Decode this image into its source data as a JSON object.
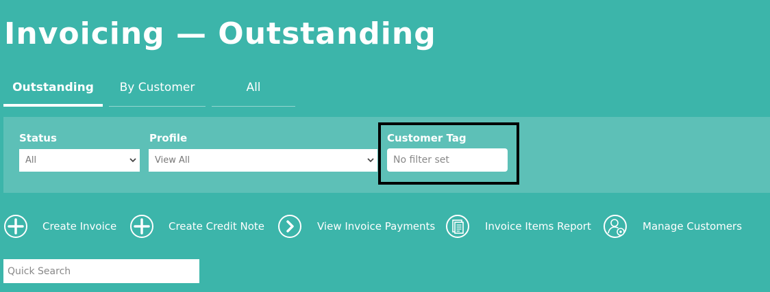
{
  "page": {
    "title": "Invoicing — Outstanding"
  },
  "tabs": [
    {
      "label": "Outstanding",
      "active": true
    },
    {
      "label": "By Customer",
      "active": false
    },
    {
      "label": "All",
      "active": false
    }
  ],
  "filters": {
    "status": {
      "label": "Status",
      "value": "All"
    },
    "profile": {
      "label": "Profile",
      "value": "View All"
    },
    "customer_tag": {
      "label": "Customer Tag",
      "value": "No filter set"
    }
  },
  "actions": [
    {
      "label": "Create Invoice",
      "icon": "plus-circle-icon"
    },
    {
      "label": "Create Credit Note",
      "icon": "plus-circle-icon"
    },
    {
      "label": "View Invoice Payments",
      "icon": "chevron-right-circle-icon"
    },
    {
      "label": "Invoice Items Report",
      "icon": "document-circle-icon"
    },
    {
      "label": "Manage Customers",
      "icon": "user-settings-circle-icon"
    }
  ],
  "search": {
    "placeholder": "Quick Search"
  },
  "colors": {
    "background": "#3cb5aa",
    "panel": "#5dc0b7",
    "text": "#ffffff",
    "highlight": "#000000"
  }
}
